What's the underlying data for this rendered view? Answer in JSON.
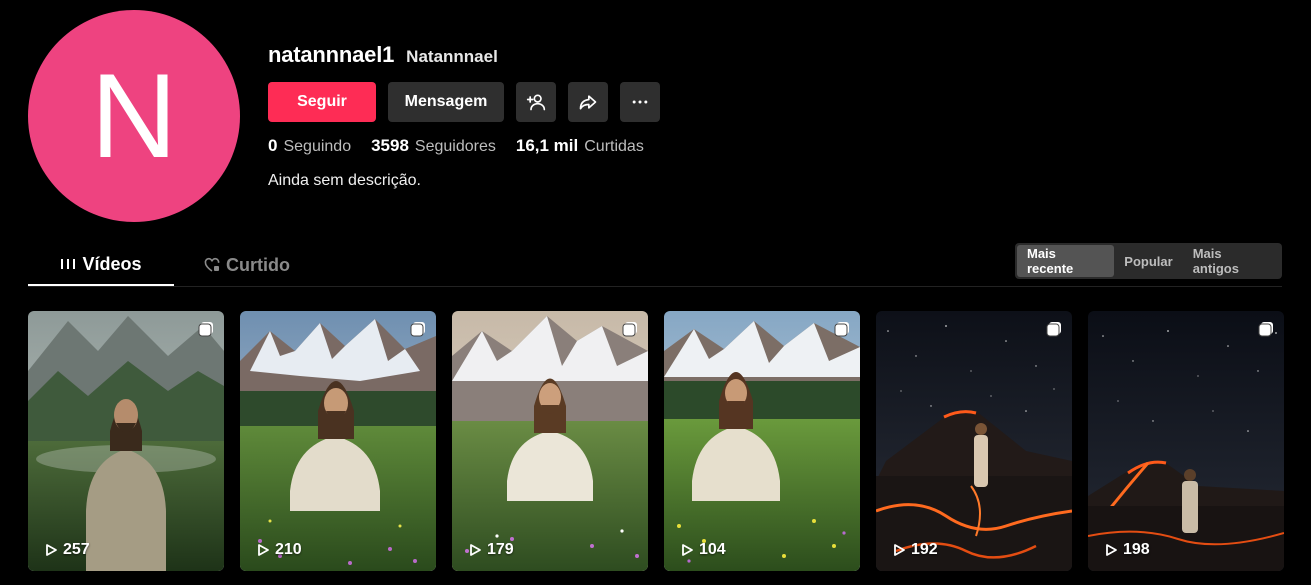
{
  "profile": {
    "avatar_letter": "N",
    "avatar_color": "#ee4380",
    "username": "natannnael1",
    "nickname": "Natannnael",
    "bio": "Ainda sem descrição."
  },
  "actions": {
    "follow_label": "Seguir",
    "message_label": "Mensagem",
    "icons": [
      "add-friend-icon",
      "share-icon",
      "more-icon"
    ]
  },
  "stats": {
    "following": {
      "value": "0",
      "label": "Seguindo"
    },
    "followers": {
      "value": "3598",
      "label": "Seguidores"
    },
    "likes": {
      "value": "16,1 mil",
      "label": "Curtidas"
    }
  },
  "tabs": [
    {
      "label": "Vídeos",
      "active": true,
      "icon": "grid-icon"
    },
    {
      "label": "Curtido",
      "active": false,
      "icon": "heart-lock-icon"
    }
  ],
  "sort": [
    {
      "label": "Mais recente",
      "active": true
    },
    {
      "label": "Popular",
      "active": false
    },
    {
      "label": "Mais antigos",
      "active": false
    }
  ],
  "videos": [
    {
      "views": "257",
      "scene": "misty-mountain-meadow"
    },
    {
      "views": "210",
      "scene": "snow-peaks-meadow"
    },
    {
      "views": "179",
      "scene": "sunlit-peaks-flowers"
    },
    {
      "views": "104",
      "scene": "snow-peaks-yellow-flowers"
    },
    {
      "views": "192",
      "scene": "starry-volcano-lava"
    },
    {
      "views": "198",
      "scene": "starry-volcano-back"
    }
  ],
  "colors": {
    "accent": "#fe2c55",
    "button_dark": "#2f2f2f",
    "background": "#000000"
  }
}
